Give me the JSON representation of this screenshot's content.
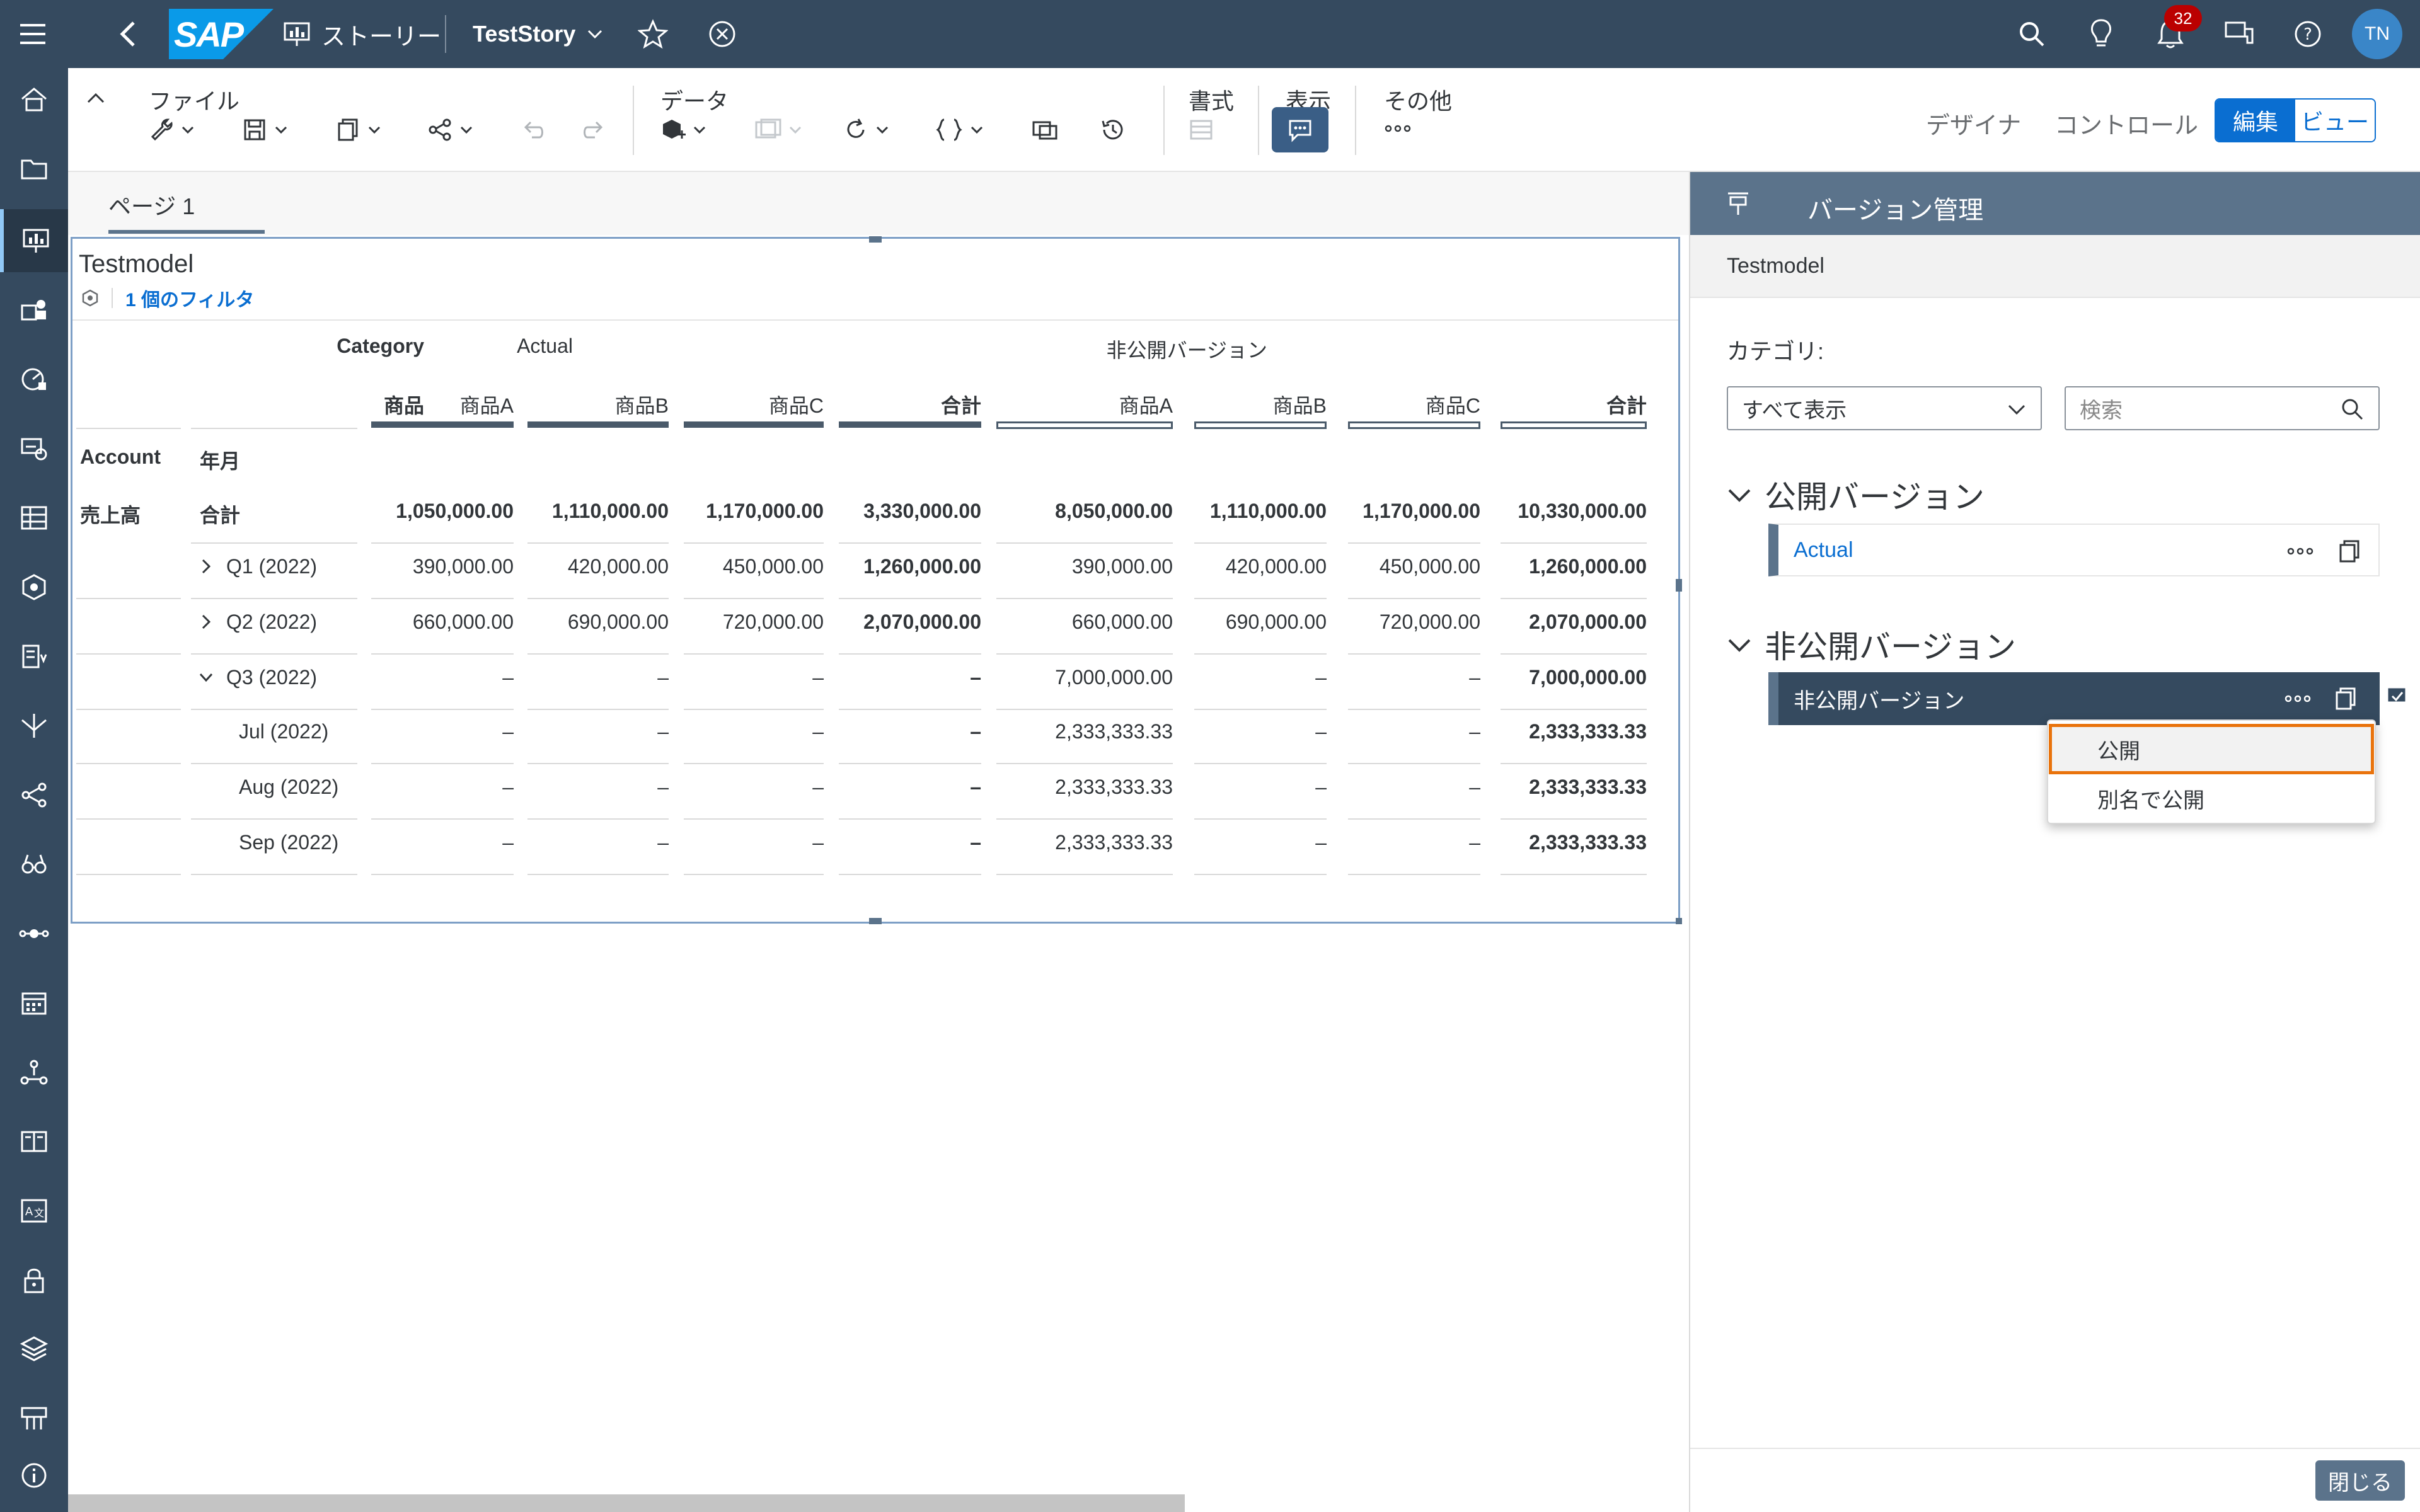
{
  "shell": {
    "story_label": "ストーリー",
    "story_name": "TestStory",
    "notifications_count": "32",
    "user_initials": "TN",
    "logo": "SAP"
  },
  "toolbar": {
    "file_label": "ファイル",
    "data_label": "データ",
    "format_label": "書式",
    "view_label": "表示",
    "more_label": "その他",
    "designer_label": "デザイナ",
    "control_label": "コントロール",
    "edit_label": "編集",
    "view_mode_label": "ビュー"
  },
  "page": {
    "tab_label": "ページ 1"
  },
  "widget": {
    "title": "Testmodel",
    "filter_text": "1 個のフィルタ"
  },
  "table": {
    "row_header_category": "Category",
    "row_header_product": "商品",
    "col_account": "Account",
    "col_month": "年月",
    "group_actual": "Actual",
    "group_private": "非公開バージョン",
    "products": [
      "商品A",
      "商品B",
      "商品C",
      "合計",
      "商品A",
      "商品B",
      "商品C",
      "合計"
    ],
    "rows": [
      {
        "account": "売上高",
        "period": "合計",
        "expand": "",
        "values": [
          "1,050,000.00",
          "1,110,000.00",
          "1,170,000.00",
          "3,330,000.00",
          "8,050,000.00",
          "1,110,000.00",
          "1,170,000.00",
          "10,330,000.00"
        ]
      },
      {
        "account": "",
        "period": "Q1 (2022)",
        "expand": "right",
        "values": [
          "390,000.00",
          "420,000.00",
          "450,000.00",
          "1,260,000.00",
          "390,000.00",
          "420,000.00",
          "450,000.00",
          "1,260,000.00"
        ]
      },
      {
        "account": "",
        "period": "Q2 (2022)",
        "expand": "right",
        "values": [
          "660,000.00",
          "690,000.00",
          "720,000.00",
          "2,070,000.00",
          "660,000.00",
          "690,000.00",
          "720,000.00",
          "2,070,000.00"
        ]
      },
      {
        "account": "",
        "period": "Q3 (2022)",
        "expand": "down",
        "values": [
          "–",
          "–",
          "–",
          "–",
          "7,000,000.00",
          "–",
          "–",
          "7,000,000.00"
        ]
      },
      {
        "account": "",
        "period": "Jul (2022)",
        "expand": "",
        "values": [
          "–",
          "–",
          "–",
          "–",
          "2,333,333.33",
          "–",
          "–",
          "2,333,333.33"
        ]
      },
      {
        "account": "",
        "period": "Aug (2022)",
        "expand": "",
        "values": [
          "–",
          "–",
          "–",
          "–",
          "2,333,333.33",
          "–",
          "–",
          "2,333,333.33"
        ]
      },
      {
        "account": "",
        "period": "Sep (2022)",
        "expand": "",
        "values": [
          "–",
          "–",
          "–",
          "–",
          "2,333,333.33",
          "–",
          "–",
          "2,333,333.33"
        ]
      }
    ]
  },
  "panel": {
    "title": "バージョン管理",
    "model": "Testmodel",
    "category_label": "カテゴリ:",
    "category_value": "すべて表示",
    "search_placeholder": "検索",
    "public_section": "公開バージョン",
    "public_version": "Actual",
    "private_section": "非公開バージョン",
    "private_version": "非公開バージョン",
    "menu_publish": "公開",
    "menu_publish_as": "別名で公開",
    "close_label": "閉じる"
  },
  "colors": {
    "shell": "#354a5f",
    "accent": "#0a6ed1",
    "highlight": "#e9730c"
  }
}
